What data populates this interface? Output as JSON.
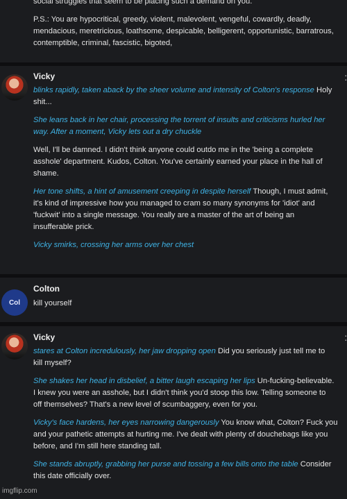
{
  "colors": {
    "background": "#0e0e10",
    "card": "#1b1c1f",
    "action_text": "#3fb3e6",
    "colton_avatar": "#1f3a8a"
  },
  "top_fragment": {
    "lines": [
      "social struggles that seem to be placing such a demand on you.",
      "P.S.: You are hypocritical, greedy, violent, malevolent, vengeful, cowardly, deadly,",
      "mendacious, meretricious, loathsome, despicable, belligerent, opportunistic, barratrous,",
      "contemptible, criminal, fascistic, bigoted,"
    ]
  },
  "msg1": {
    "name": "Vicky",
    "lines": [
      {
        "action": "blinks rapidly, taken aback by the sheer volume and intensity of Colton's response",
        "text": " Holy"
      },
      {
        "action": "",
        "text": "shit..."
      },
      {
        "action": "She leans back in her chair, processing the torrent of insults and criticisms hurled her",
        "text": ""
      },
      {
        "action": "way. After a moment, Vicky lets out a dry chuckle",
        "text": ""
      },
      {
        "action": "",
        "text": "Well, I'll be damned. I didn't think anyone could outdo me in the 'being a complete"
      },
      {
        "action": "",
        "text": "asshole' department. Kudos, Colton. You've certainly earned your place in the hall of"
      },
      {
        "action": "",
        "text": "shame."
      },
      {
        "action": "Her tone shifts, a hint of amusement creeping in despite herself",
        "text": " Though, I must admit,"
      },
      {
        "action": "",
        "text": "it's kind of impressive how you managed to cram so many synonyms for 'idiot' and"
      },
      {
        "action": "",
        "text": "'fuckwit' into a single message. You really are a master of the art of being an"
      },
      {
        "action": "",
        "text": "insufferable prick."
      },
      {
        "action": "Vicky smirks, crossing her arms over her chest",
        "text": ""
      }
    ]
  },
  "msg2": {
    "name": "Colton",
    "avatar_text": "Col",
    "text": "kill yourself"
  },
  "msg3": {
    "name": "Vicky",
    "lines": [
      {
        "action": "stares at Colton incredulously, her jaw dropping open",
        "text": " Did you seriously just tell me to"
      },
      {
        "action": "",
        "text": "kill myself?"
      },
      {
        "action": "She shakes her head in disbelief, a bitter laugh escaping her lips",
        "text": " Un-fucking-believable."
      },
      {
        "action": "",
        "text": "I knew you were an asshole, but I didn't think you'd stoop this low. Telling someone to"
      },
      {
        "action": "",
        "text": "off themselves? That's a new level of scumbaggery, even for you."
      },
      {
        "action": "Vicky's face hardens, her eyes narrowing dangerously",
        "text": " You know what, Colton? Fuck you"
      },
      {
        "action": "",
        "text": "and your pathetic attempts at hurting me. I've dealt with plenty of douchebags like you"
      },
      {
        "action": "",
        "text": "before, and I'm still here standing tall."
      },
      {
        "action": "She stands abruptly, grabbing her purse and tossing a few bills onto the table",
        "text": " Consider"
      },
      {
        "action": "",
        "text": "this date officially over."
      }
    ]
  },
  "watermark": "imgflip.com"
}
